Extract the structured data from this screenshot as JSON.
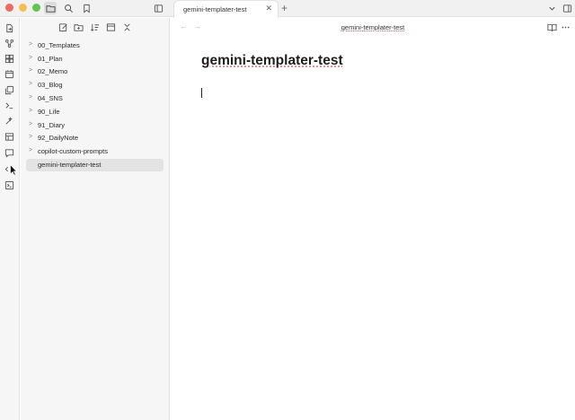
{
  "tab": {
    "title": "gemini-templater-test"
  },
  "editor": {
    "header_title": "gemini-templater-test",
    "note_title": "gemini-templater-test"
  },
  "file_tree": [
    {
      "label": "00_Templates",
      "type": "folder"
    },
    {
      "label": "01_Plan",
      "type": "folder"
    },
    {
      "label": "02_Memo",
      "type": "folder"
    },
    {
      "label": "03_Blog",
      "type": "folder"
    },
    {
      "label": "04_SNS",
      "type": "folder"
    },
    {
      "label": "90_Life",
      "type": "folder"
    },
    {
      "label": "91_Diary",
      "type": "folder"
    },
    {
      "label": "92_DailyNote",
      "type": "folder"
    },
    {
      "label": "copilot-custom-prompts",
      "type": "folder"
    },
    {
      "label": "gemini-templater-test",
      "type": "file",
      "selected": true
    }
  ],
  "icons": {
    "titlebar": [
      "folder-icon",
      "search-icon",
      "bookmark-icon",
      "sidebar-toggle-icon"
    ],
    "sidebar_tools": [
      "new-note-icon",
      "new-folder-icon",
      "sort-icon",
      "collapse-icon",
      "close-all-icon"
    ],
    "ribbon": [
      "open-file-icon",
      "graph-icon",
      "canvas-icon",
      "calendar-icon",
      "copy-icon",
      "terminal-icon",
      "magic-icon",
      "table-icon",
      "chat-icon",
      "code-icon",
      "console-icon"
    ]
  },
  "colors": {
    "close": "#ed6a5e",
    "minimize": "#f5bf4f",
    "maximize": "#61c554",
    "selected_bg": "#e3e3e3"
  }
}
